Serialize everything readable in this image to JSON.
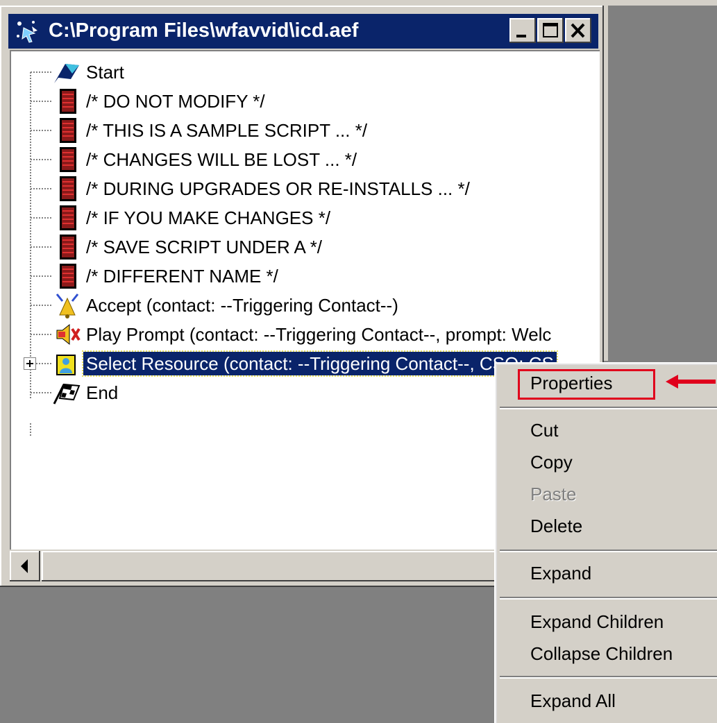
{
  "window": {
    "title": "C:\\Program Files\\wfavvid\\icd.aef"
  },
  "tree": {
    "items": [
      {
        "label": "Start",
        "icon": "start-flag-icon"
      },
      {
        "label": "/* DO NOT MODIFY  */",
        "icon": "comment-icon"
      },
      {
        "label": "/* THIS IS A SAMPLE SCRIPT ... */",
        "icon": "comment-icon"
      },
      {
        "label": "/* CHANGES WILL BE LOST ... */",
        "icon": "comment-icon"
      },
      {
        "label": "/* DURING UPGRADES OR RE-INSTALLS ... */",
        "icon": "comment-icon"
      },
      {
        "label": "/* IF YOU MAKE CHANGES */",
        "icon": "comment-icon"
      },
      {
        "label": "/* SAVE SCRIPT UNDER A */",
        "icon": "comment-icon"
      },
      {
        "label": "/* DIFFERENT NAME */",
        "icon": "comment-icon"
      },
      {
        "label": "Accept (contact: --Triggering Contact--)",
        "icon": "accept-bell-icon"
      },
      {
        "label": "Play Prompt (contact: --Triggering Contact--, prompt: Welc",
        "icon": "play-prompt-icon"
      },
      {
        "label": "Select Resource (contact: --Triggering Contact--, CSQ: CS",
        "icon": "select-resource-icon"
      },
      {
        "label": "End",
        "icon": "end-flag-icon"
      }
    ],
    "selected_index": 10
  },
  "context_menu": {
    "properties": "Properties",
    "cut": "Cut",
    "copy": "Copy",
    "paste": "Paste",
    "delete": "Delete",
    "expand": "Expand",
    "expand_children": "Expand Children",
    "collapse_children": "Collapse Children",
    "expand_all": "Expand All"
  },
  "colors": {
    "titlebar": "#0a246a",
    "selection": "#0a246a",
    "callout": "#e0001c",
    "face": "#d4d0c8"
  }
}
